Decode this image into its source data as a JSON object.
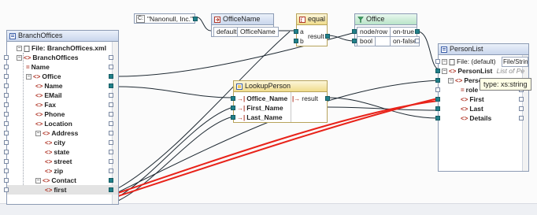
{
  "branch_offices": {
    "title": "BranchOffices",
    "file_label": "File: BranchOffices.xml",
    "items": [
      {
        "tag": "<>",
        "label": "BranchOffices"
      },
      {
        "tag": "=",
        "label": "Name"
      },
      {
        "tag": "<>",
        "label": "Office"
      },
      {
        "tag": "<>",
        "label": "Name"
      },
      {
        "tag": "<>",
        "label": "EMail"
      },
      {
        "tag": "<>",
        "label": "Fax"
      },
      {
        "tag": "<>",
        "label": "Phone"
      },
      {
        "tag": "<>",
        "label": "Location"
      },
      {
        "tag": "<>",
        "label": "Address"
      },
      {
        "tag": "<>",
        "label": "city"
      },
      {
        "tag": "<>",
        "label": "state"
      },
      {
        "tag": "<>",
        "label": "street"
      },
      {
        "tag": "<>",
        "label": "zip"
      },
      {
        "tag": "<>",
        "label": "Contact"
      },
      {
        "tag": "<>",
        "label": "first"
      }
    ]
  },
  "constant": {
    "label": "\"Nanonull, Inc.\""
  },
  "office_name": {
    "title": "OfficeName",
    "default_label": "default",
    "value_label": "OfficeName"
  },
  "equal": {
    "title": "equal",
    "a": "a",
    "b": "b",
    "result": "result"
  },
  "office_filter": {
    "title": "Office",
    "node_row": "node/row",
    "on_true": "on-true",
    "bool": "bool",
    "on_false": "on-false"
  },
  "lookup": {
    "title": "LookupPerson",
    "inputs": [
      "Office_Name",
      "First_Name",
      "Last_Name"
    ],
    "result": "result"
  },
  "person_list": {
    "title": "PersonList",
    "file_label": "File: (default)",
    "file_button": "File/String",
    "person_list_label": "PersonList",
    "person_list_hint": "List of Pe",
    "items": [
      {
        "tag": "<>",
        "label": "Person"
      },
      {
        "tag": "=",
        "label": "role"
      },
      {
        "tag": "<>",
        "label": "First"
      },
      {
        "tag": "<>",
        "label": "Last"
      },
      {
        "tag": "<>",
        "label": "Details"
      }
    ]
  },
  "tooltip": "type: xs:string",
  "colors": {
    "wire": "#1f2a33",
    "highlight": "#e8231a",
    "pin_active": "#21808a",
    "header": "#c9d6ec"
  }
}
